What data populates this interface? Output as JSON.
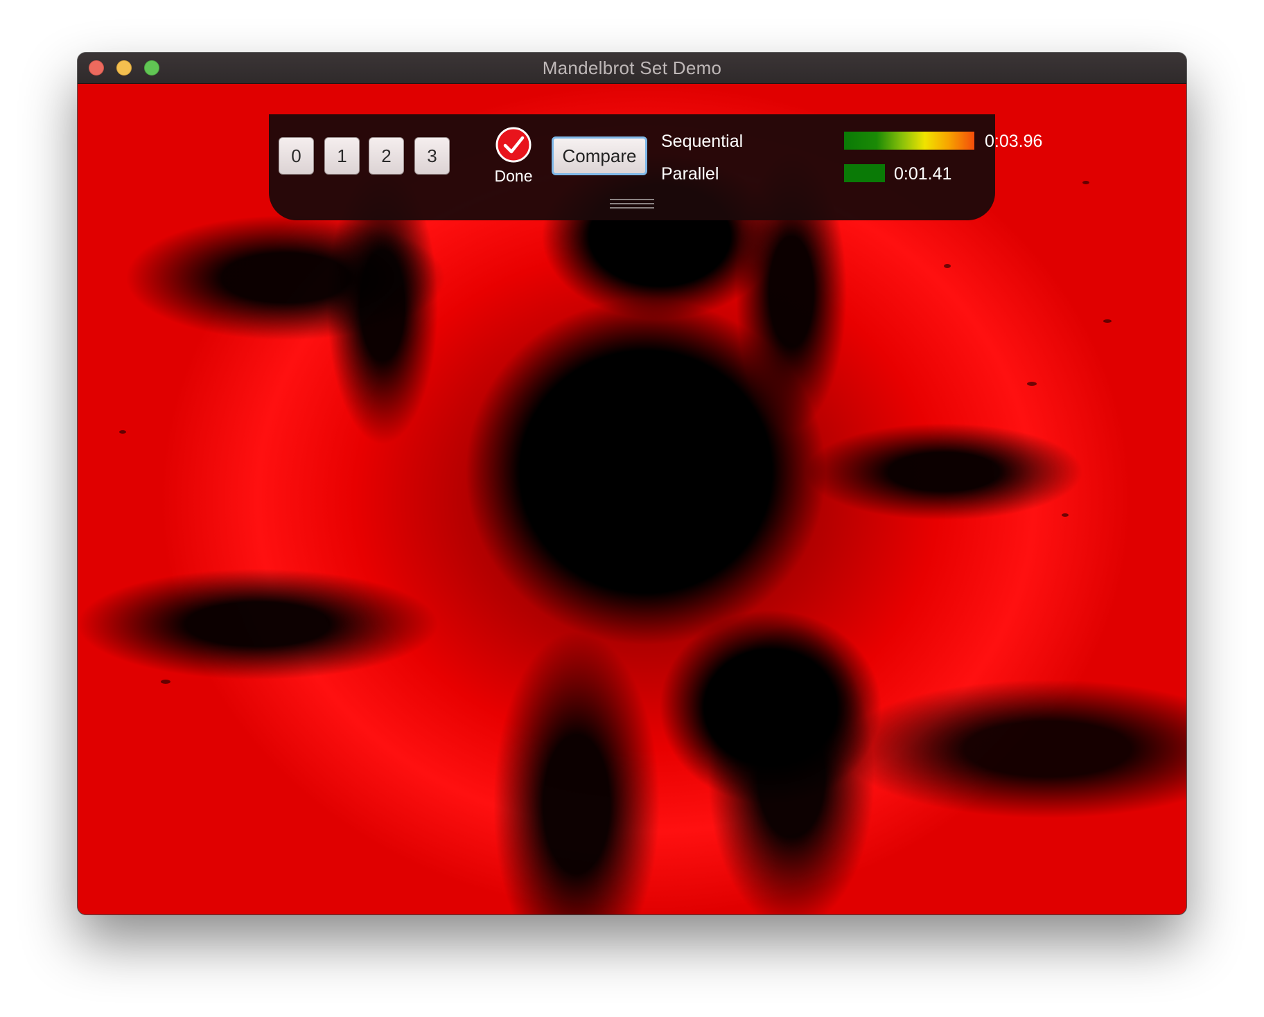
{
  "window": {
    "title": "Mandelbrot Set Demo"
  },
  "toolbar": {
    "buttons": [
      "0",
      "1",
      "2",
      "3"
    ],
    "status_label": "Done",
    "compare_label": "Compare",
    "sequential_label": "Sequential",
    "sequential_time": "0:03.96",
    "parallel_label": "Parallel",
    "parallel_time": "0:01.41"
  },
  "colors": {
    "fractal": "#ff0000",
    "done_icon": "#e8141c",
    "parallel_bar": "#0a7a06"
  },
  "icons": {
    "status": "checkmark-circle-icon",
    "grip": "drag-handle-icon"
  }
}
